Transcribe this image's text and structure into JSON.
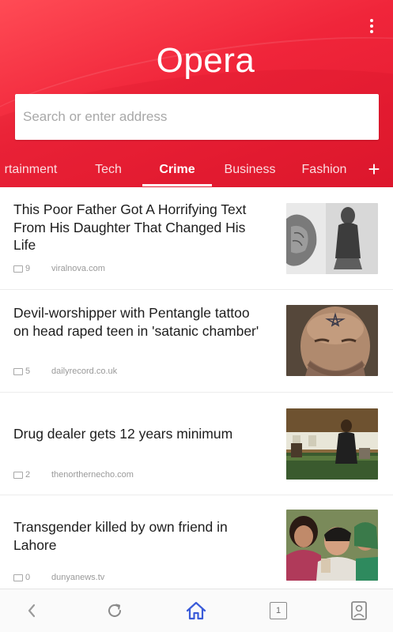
{
  "header": {
    "logo": "Opera",
    "search": {
      "placeholder": "Search or enter address",
      "value": ""
    }
  },
  "tabs": [
    {
      "label": "rtainment"
    },
    {
      "label": "Tech"
    },
    {
      "label": "Crime"
    },
    {
      "label": "Business"
    },
    {
      "label": "Fashion"
    }
  ],
  "active_tab": "Crime",
  "feed": [
    {
      "title": "This Poor Father Got A Horrifying Text From His Daughter That Changed His Life",
      "count": "9",
      "source": "viralnova.com"
    },
    {
      "title": "Devil-worshipper with Pentangle tattoo on head raped teen in 'satanic chamber'",
      "count": "5",
      "source": "dailyrecord.co.uk"
    },
    {
      "title": "Drug dealer gets 12 years minimum",
      "count": "2",
      "source": "thenorthernecho.com"
    },
    {
      "title": "Transgender killed by own friend in Lahore",
      "count": "0",
      "source": "dunyanews.tv"
    }
  ],
  "colors": {
    "brand": "#f0253a",
    "accent_blue": "#3a5bd9"
  },
  "icons": {
    "menu": "vertical-dots-icon",
    "add_tab": "plus-icon",
    "back": "back-arrow-icon",
    "reload": "reload-icon",
    "home": "home-icon",
    "tabs": "tabs-counter-icon",
    "account": "account-icon"
  },
  "bottom_bar": {
    "tab_count": "1"
  }
}
